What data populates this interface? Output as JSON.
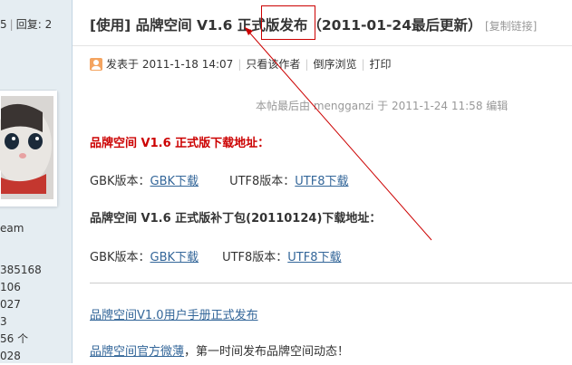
{
  "sidebar": {
    "stats_left": "5",
    "stats_label": "回复:",
    "stats_value": "2",
    "group": "eam",
    "list": [
      "385168",
      "106",
      "027",
      "3",
      "56 个",
      "028"
    ]
  },
  "post": {
    "title_prefix": "[使用] 品牌空间 ",
    "title_version": "V1.6",
    "title_suffix": " 正式版发布（2011-01-24最后更新）",
    "copy_link": "[复制链接]",
    "posted_label": "发表于 2011-1-18 14:07",
    "only_author": "只看该作者",
    "reverse_view": "倒序浏览",
    "print": "打印",
    "edit_note": "本帖最后由 mengganzi 于 2011-1-24 11:58 编辑",
    "download_heading": "品牌空间 V1.6 正式版下载地址：",
    "gbk_label": "GBK版本：",
    "gbk_link": "GBK下载",
    "utf8_label": "UTF8版本：",
    "utf8_link": "UTF8下载",
    "patch_heading": "品牌空间 V1.6 正式版补丁包(20110124)下载地址：",
    "patch_gbk_label": "GBK版本：",
    "patch_gbk_link": "GBK下载",
    "patch_utf8_label": "UTF8版本：",
    "patch_utf8_link": "UTF8下载",
    "manual_link": "品牌空间V1.0用户手册正式发布",
    "weibo_link": "品牌空间官方微薄",
    "weibo_suffix": "，第一时间发布品牌空间动态！"
  },
  "colors": {
    "accent_red": "#cc0000",
    "link_blue": "#336699",
    "sidebar_bg": "#e5edf2"
  }
}
